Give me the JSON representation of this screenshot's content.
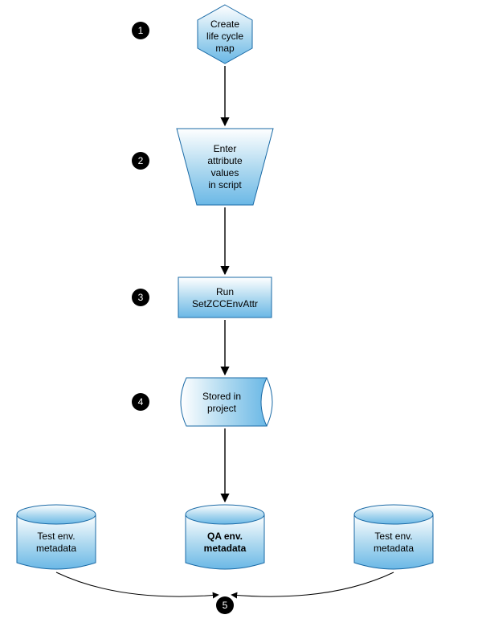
{
  "steps": {
    "marker1": "1",
    "marker2": "2",
    "marker3": "3",
    "marker4": "4",
    "marker5": "5"
  },
  "nodes": {
    "hexagon": {
      "line1": "Create",
      "line2": "life cycle",
      "line3": "map"
    },
    "trapezoid": {
      "line1": "Enter",
      "line2": "attribute",
      "line3": "values",
      "line4": "in script"
    },
    "rect": {
      "line1": "Run",
      "line2": "SetZCCEnvAttr"
    },
    "storage": {
      "line1": "Stored in",
      "line2": "project"
    },
    "cyl_left": {
      "line1": "Test env.",
      "line2": "metadata"
    },
    "cyl_mid": {
      "line1": "QA env.",
      "line2": "metadata"
    },
    "cyl_right": {
      "line1": "Test env.",
      "line2": "metadata"
    }
  },
  "chart_data": {
    "type": "flowchart",
    "nodes": [
      {
        "id": "n1",
        "step": 1,
        "shape": "hexagon",
        "label": "Create life cycle map"
      },
      {
        "id": "n2",
        "step": 2,
        "shape": "trapezoid",
        "label": "Enter attribute values in script"
      },
      {
        "id": "n3",
        "step": 3,
        "shape": "process",
        "label": "Run SetZCCEnvAttr"
      },
      {
        "id": "n4",
        "step": 4,
        "shape": "storage",
        "label": "Stored in project"
      },
      {
        "id": "cL",
        "step": 5,
        "shape": "cylinder",
        "label": "Test env. metadata"
      },
      {
        "id": "cM",
        "step": 5,
        "shape": "cylinder",
        "label": "QA env. metadata"
      },
      {
        "id": "cR",
        "step": 5,
        "shape": "cylinder",
        "label": "Test env. metadata"
      }
    ],
    "edges": [
      {
        "from": "n1",
        "to": "n2"
      },
      {
        "from": "n2",
        "to": "n3"
      },
      {
        "from": "n3",
        "to": "n4"
      },
      {
        "from": "n4",
        "to": "cM"
      },
      {
        "from": "cL",
        "to": "merge5"
      },
      {
        "from": "cR",
        "to": "merge5"
      }
    ]
  }
}
